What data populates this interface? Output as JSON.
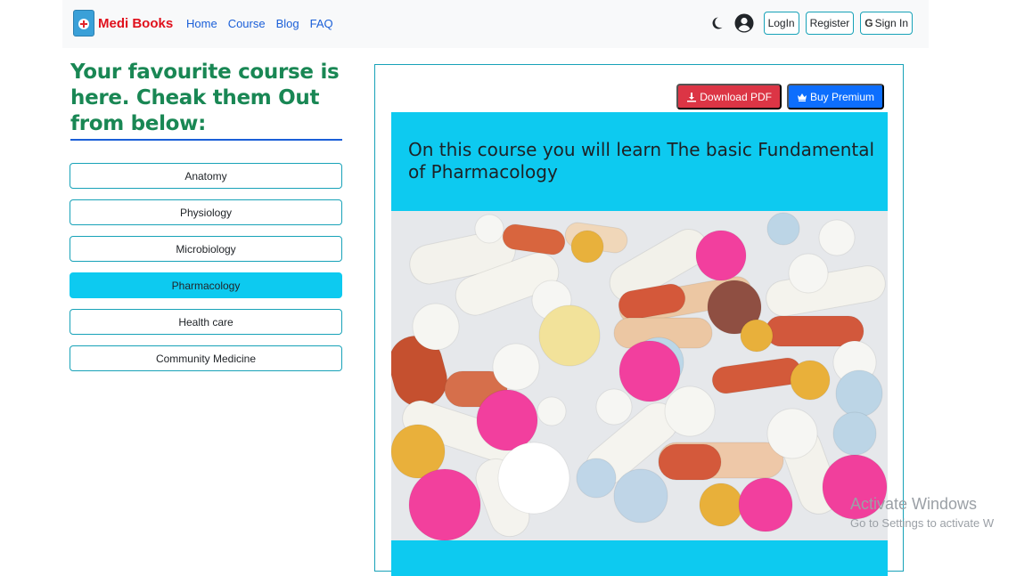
{
  "brand": {
    "name": "Medi Books"
  },
  "nav": {
    "home": "Home",
    "course": "Course",
    "blog": "Blog",
    "faq": "FAQ"
  },
  "nav_right": {
    "login": "LogIn",
    "register": "Register",
    "google_signin": "Sign In",
    "google_letter": "G"
  },
  "sidebar": {
    "heading": "Your favourite course is here. Cheak them Out from below:",
    "courses": [
      {
        "label": "Anatomy"
      },
      {
        "label": "Physiology"
      },
      {
        "label": "Microbiology"
      },
      {
        "label": "Pharmacology"
      },
      {
        "label": "Health care"
      },
      {
        "label": "Community Medicine"
      }
    ],
    "active_course": "Pharmacology"
  },
  "main": {
    "download_label": "Download PDF",
    "premium_label": "Buy Premium",
    "banner_text": "On this course you will learn The basic Fundamental of Pharmacology"
  },
  "watermark": {
    "title": "Activate Windows",
    "subtitle": "Go to Settings to activate W"
  },
  "colors": {
    "brand_red": "#e0101c",
    "heading_green": "#198754",
    "cyan": "#0dcaf0",
    "danger": "#dc3545",
    "primary": "#0d6efd",
    "outline": "#17a2b8"
  },
  "icons": [
    "medical-book-icon",
    "moon-icon",
    "user-circle-icon",
    "google-icon",
    "download-icon",
    "crown-icon"
  ]
}
